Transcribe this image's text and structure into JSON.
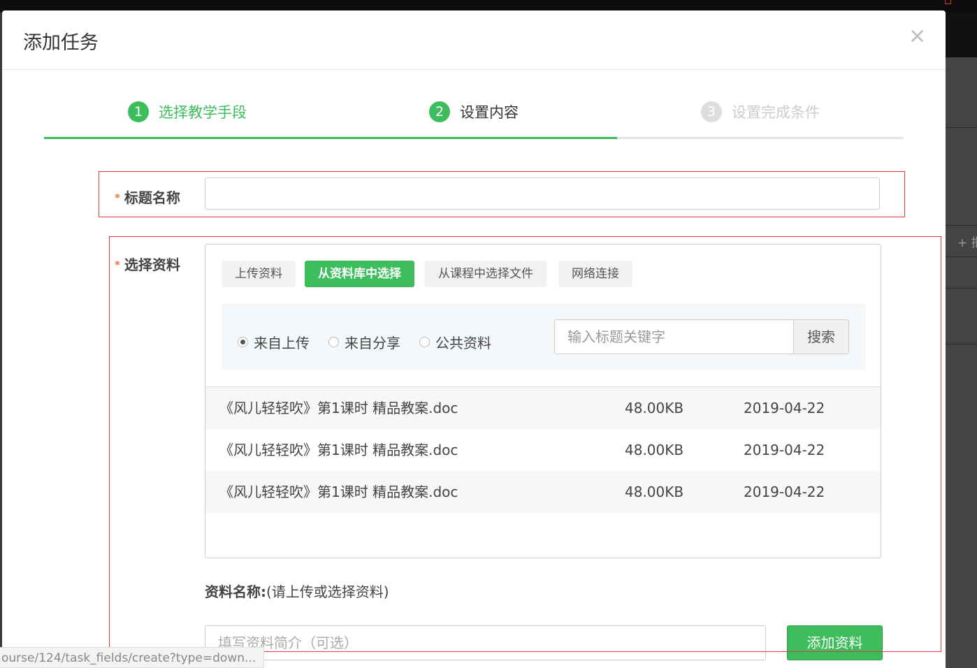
{
  "modal": {
    "title": "添加任务",
    "close_icon": "×"
  },
  "steps": [
    {
      "num": "1",
      "label": "选择教学手段",
      "state": "done"
    },
    {
      "num": "2",
      "label": "设置内容",
      "state": "current"
    },
    {
      "num": "3",
      "label": "设置完成条件",
      "state": "pending"
    }
  ],
  "progress": {
    "fraction": 0.667
  },
  "colors": {
    "accent": "#3dbd5c",
    "required": "#e8743b",
    "annotation": "#e03a3a"
  },
  "form": {
    "required_mark": "*",
    "title_label": "标题名称",
    "title_value": "",
    "material_label": "选择资料",
    "tabs": [
      {
        "label": "上传资料",
        "active": false
      },
      {
        "label": "从资料库中选择",
        "active": true
      },
      {
        "label": "从课程中选择文件",
        "active": false
      },
      {
        "label": "网络连接",
        "active": false
      }
    ],
    "sources": [
      {
        "label": "来自上传",
        "checked": true
      },
      {
        "label": "来自分享",
        "checked": false
      },
      {
        "label": "公共资料",
        "checked": false
      }
    ],
    "search_placeholder": "输入标题关键字",
    "search_button": "搜索",
    "files": [
      {
        "name": "《风儿轻轻吹》第1课时 精品教案.doc",
        "size": "48.00KB",
        "date": "2019-04-22"
      },
      {
        "name": "《风儿轻轻吹》第1课时 精品教案.doc",
        "size": "48.00KB",
        "date": "2019-04-22"
      },
      {
        "name": "《风儿轻轻吹》第1课时 精品教案.doc",
        "size": "48.00KB",
        "date": "2019-04-22"
      }
    ],
    "material_name_label": "资料名称:",
    "material_name_hint": "(请上传或选择资料)",
    "desc_placeholder": "填写资料简介（可选）",
    "add_button": "添加资料"
  },
  "background": {
    "right_label": "+ 批量"
  },
  "status_bar": {
    "url": "ourse/124/task_fields/create?type=down..."
  }
}
